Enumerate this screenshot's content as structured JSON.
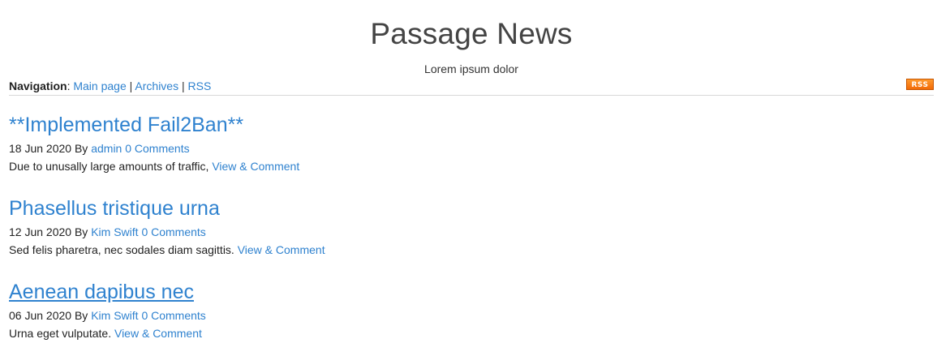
{
  "header": {
    "title": "Passage News",
    "subtitle": "Lorem ipsum dolor"
  },
  "nav": {
    "label": "Navigation",
    "colon": ":",
    "separator": "|",
    "links": [
      "Main page",
      "Archives",
      "RSS"
    ],
    "rss_badge": "RSS",
    "rss_badge_color": "#f57c12"
  },
  "posts": [
    {
      "title": "**Implemented Fail2Ban**",
      "date": "18 Jun 2020",
      "by": "By",
      "author": "admin",
      "comments": "0 Comments",
      "excerpt": "Due to unusally large amounts of traffic,",
      "link": "View & Comment"
    },
    {
      "title": "Phasellus tristique urna",
      "date": "12 Jun 2020",
      "by": "By",
      "author": "Kim Swift",
      "comments": "0 Comments",
      "excerpt": "Sed felis pharetra, nec sodales diam sagittis.",
      "link": "View & Comment"
    },
    {
      "title": "Aenean dapibus nec",
      "date": "06 Jun 2020",
      "by": "By",
      "author": "Kim Swift",
      "comments": "0 Comments",
      "excerpt": "Urna eget vulputate.",
      "link": "View & Comment"
    }
  ],
  "colors": {
    "link": "#2f82cf",
    "text": "#222222"
  }
}
